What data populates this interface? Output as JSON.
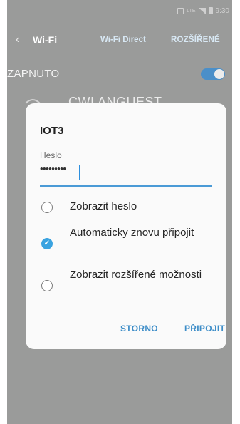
{
  "status_bar": {
    "lte": "LTE",
    "time": "9:30"
  },
  "header": {
    "back_icon": "‹",
    "title": "Wi-Fi",
    "tab_direct": "Wi-Fi Direct",
    "tab_advanced": "ROZŠÍŘENÉ"
  },
  "wifi_switch": {
    "label": "ZAPNUTO",
    "on": true,
    "accent": "#4a8fc9"
  },
  "background_network": {
    "name": "CWI ANGUEST"
  },
  "dialog": {
    "title": "IOT3",
    "password_label": "Heslo",
    "password_value": "•••••••••",
    "options": [
      {
        "label": "Zobrazit heslo",
        "checked": false
      },
      {
        "label": "Automaticky znovu připojit",
        "checked": true
      },
      {
        "label": "Zobrazit rozšířené možnosti",
        "checked": false
      }
    ],
    "cancel_label": "STORNO",
    "connect_label": "PŘIPOJIT",
    "accent": "#3d8dc8"
  }
}
